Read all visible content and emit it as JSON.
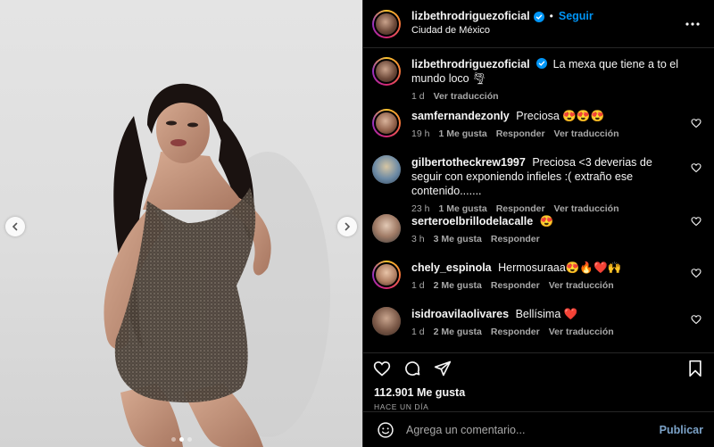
{
  "colors": {
    "accent": "#0095f6",
    "background": "#000000",
    "muted": "#a8a8a8",
    "like": "#ff3040"
  },
  "post": {
    "carousel": {
      "slide_count": 3,
      "active_slide": 1
    }
  },
  "header": {
    "username": "lizbethrodriguezoficial",
    "separator": "•",
    "follow_label": "Seguir",
    "location": "Ciudad de México"
  },
  "caption": {
    "username": "lizbethrodriguezoficial",
    "text": "La mexa que tiene a to el mundo loco 🌪",
    "time": "1 d",
    "translate": "Ver traducción"
  },
  "comments": [
    {
      "username": "samfernandezonly",
      "text": "Preciosa 😍😍😍",
      "time": "19 h",
      "likes": "1 Me gusta",
      "reply": "Responder",
      "translate": "Ver traducción"
    },
    {
      "username": "gilbertotheckrew1997",
      "text": "Preciosa <3 deverias de seguir con exponiendo infieles :( extraño ese contenido.......",
      "time": "23 h",
      "likes": "1 Me gusta",
      "reply": "Responder",
      "translate": "Ver traducción"
    },
    {
      "username": "serteroelbrillodelacalle",
      "text": "😍",
      "time": "3 h",
      "likes": "3 Me gusta",
      "reply": "Responder",
      "translate": ""
    },
    {
      "username": "chely_espinola",
      "text": "Hermosuraaa😍🔥❤️🙌",
      "time": "1 d",
      "likes": "2 Me gusta",
      "reply": "Responder",
      "translate": "Ver traducción"
    },
    {
      "username": "isidroavilaolivares",
      "text": "Bellísima ❤️",
      "time": "1 d",
      "likes": "2 Me gusta",
      "reply": "Responder",
      "translate": "Ver traducción"
    }
  ],
  "stats": {
    "likes": "112.901 Me gusta",
    "posted": "HACE UN DÍA"
  },
  "composer": {
    "placeholder": "Agrega un comentario...",
    "publish_label": "Publicar"
  },
  "icons": {
    "more": "more-options-icon",
    "like": "heart-icon",
    "comment": "comment-icon",
    "share": "share-icon",
    "save": "bookmark-icon",
    "emoji": "emoji-icon",
    "verified": "verified-badge-icon"
  }
}
